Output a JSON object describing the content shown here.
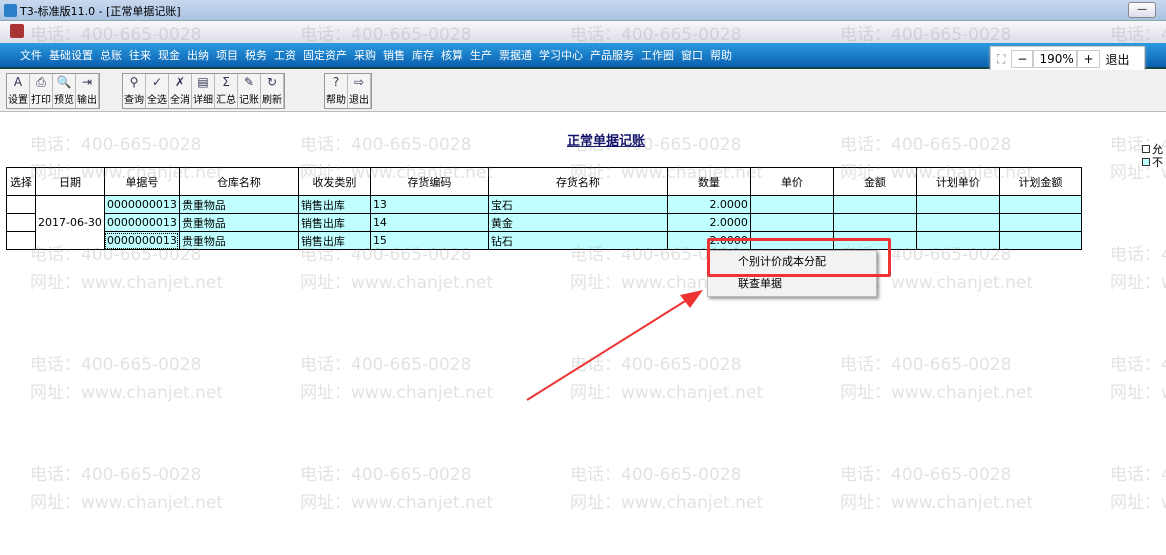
{
  "window": {
    "title": "T3-标准版11.0 - [正常单据记账]"
  },
  "menu": [
    "文件",
    "基础设置",
    "总账",
    "往来",
    "现金",
    "出纳",
    "项目",
    "税务",
    "工资",
    "固定资产",
    "采购",
    "销售",
    "库存",
    "核算",
    "生产",
    "票据通",
    "学习中心",
    "产品服务",
    "工作圈",
    "窗口",
    "帮助"
  ],
  "zoom": {
    "value": "190%",
    "minus": "−",
    "plus": "+",
    "exit": "退出"
  },
  "toolbar": {
    "groups": [
      [
        {
          "label": "设置",
          "icon": "settings-icon",
          "g": "A"
        },
        {
          "label": "打印",
          "icon": "print-icon",
          "g": "⎙"
        },
        {
          "label": "预览",
          "icon": "preview-icon",
          "g": "🔍"
        },
        {
          "label": "输出",
          "icon": "export-icon",
          "g": "⇥"
        }
      ],
      [
        {
          "label": "查询",
          "icon": "binoculars-icon",
          "g": "⚲"
        },
        {
          "label": "全选",
          "icon": "select-all-icon",
          "g": "✓"
        },
        {
          "label": "全消",
          "icon": "deselect-all-icon",
          "g": "✗"
        },
        {
          "label": "详细",
          "icon": "detail-icon",
          "g": "▤"
        },
        {
          "label": "汇总",
          "icon": "sum-icon",
          "g": "Σ"
        },
        {
          "label": "记账",
          "icon": "post-icon",
          "g": "✎"
        },
        {
          "label": "刷新",
          "icon": "refresh-icon",
          "g": "↻"
        }
      ],
      [
        {
          "label": "帮助",
          "icon": "help-icon",
          "g": "?"
        },
        {
          "label": "退出",
          "icon": "exit-icon",
          "g": "⇨"
        }
      ]
    ]
  },
  "page": {
    "title": "正常单据记账",
    "legend": [
      "允",
      "不"
    ]
  },
  "table": {
    "columns": [
      "选择",
      "日期",
      "单据号",
      "仓库名称",
      "收发类别",
      "存货编码",
      "存货名称",
      "数量",
      "单价",
      "金额",
      "计划单价",
      "计划金额"
    ],
    "date": "2017-06-30",
    "rows": [
      [
        "",
        "",
        "0000000013",
        "贵重物品",
        "销售出库",
        "13",
        "宝石",
        "2.0000",
        "",
        "",
        "",
        ""
      ],
      [
        "",
        "",
        "0000000013",
        "贵重物品",
        "销售出库",
        "14",
        "黄金",
        "2.0000",
        "",
        "",
        "",
        ""
      ],
      [
        "",
        "",
        "0000000013",
        "贵重物品",
        "销售出库",
        "15",
        "钻石",
        "2.0000",
        "",
        "",
        "",
        ""
      ]
    ]
  },
  "context_menu": [
    "个别计价成本分配",
    "联查单据"
  ],
  "watermark": {
    "phone": "电话：400-665-0028",
    "url": "网址：www.chanjet.net"
  },
  "colors": {
    "menubar": "#0a5fae",
    "row_bg": "#c0ffff",
    "highlight": "#e33333"
  }
}
